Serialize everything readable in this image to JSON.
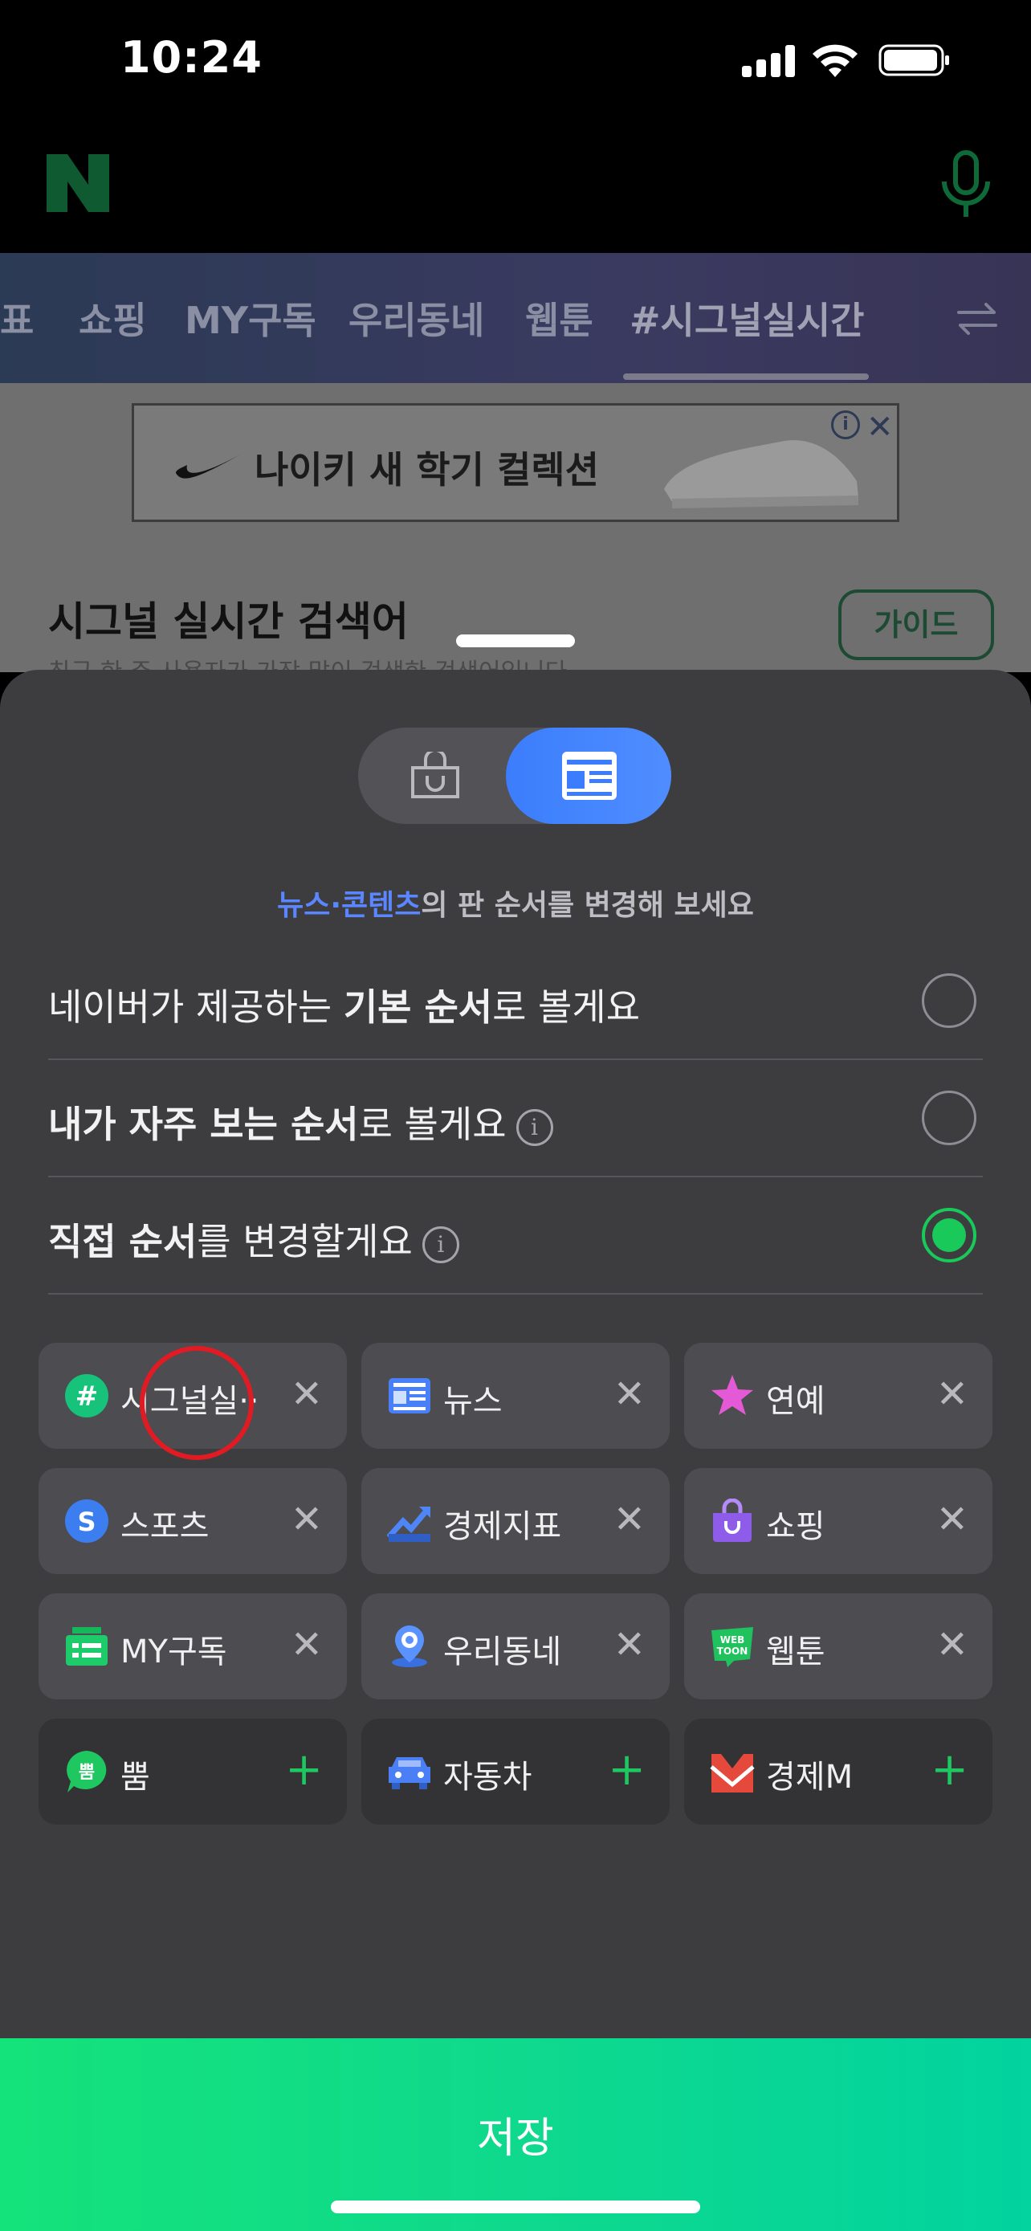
{
  "status_bar": {
    "time": "10:24"
  },
  "tabs": [
    {
      "label": "표"
    },
    {
      "label": "쇼핑"
    },
    {
      "label": "MY구독"
    },
    {
      "label": "우리동네"
    },
    {
      "label": "웹툰"
    },
    {
      "label": "#시그널실시간",
      "active": true
    }
  ],
  "ad": {
    "text": "나이키 새 학기 컬렉션",
    "info": "i",
    "close": "✕"
  },
  "section": {
    "title": "시그널 실시간 검색어",
    "subtitle": "최근 한 주 사용자가 가장 많이 검색한 검색어입니다",
    "guide_button": "가이드"
  },
  "sheet": {
    "hint_accent": "뉴스·콘텐츠",
    "hint_rest": "의 판 순서를 변경해 보세요",
    "options": [
      {
        "pre": "네이버가 제공하는 ",
        "bold": "기본 순서",
        "post": "로 볼게요",
        "info": false,
        "selected": false
      },
      {
        "pre": "",
        "bold": "내가 자주 보는 순서",
        "post": "로 볼게요",
        "info": true,
        "selected": false
      },
      {
        "pre": "",
        "bold": "직접 순서",
        "post": "를 변경할게요",
        "info": true,
        "selected": true
      }
    ],
    "chips": [
      {
        "label": "시그널실··",
        "icon": "hashtag-icon",
        "action": "✕",
        "added": true
      },
      {
        "label": "뉴스",
        "icon": "news-icon",
        "action": "✕",
        "added": true
      },
      {
        "label": "연예",
        "icon": "star-icon",
        "action": "✕",
        "added": true
      },
      {
        "label": "스포츠",
        "icon": "sports-icon",
        "action": "✕",
        "added": true
      },
      {
        "label": "경제지표",
        "icon": "chart-icon",
        "action": "✕",
        "added": true
      },
      {
        "label": "쇼핑",
        "icon": "shopping-bag-icon",
        "action": "✕",
        "added": true
      },
      {
        "label": "MY구독",
        "icon": "subscription-icon",
        "action": "✕",
        "added": true
      },
      {
        "label": "우리동네",
        "icon": "location-icon",
        "action": "✕",
        "added": true
      },
      {
        "label": "웹툰",
        "icon": "webtoon-icon",
        "action": "✕",
        "added": true
      },
      {
        "label": "뿜",
        "icon": "ppum-icon",
        "action": "+",
        "added": false
      },
      {
        "label": "자동차",
        "icon": "car-icon",
        "action": "+",
        "added": false
      },
      {
        "label": "경제M",
        "icon": "economy-m-icon",
        "action": "+",
        "added": false
      }
    ],
    "save": "저장"
  },
  "colors": {
    "accent_green": "#19c95a",
    "accent_blue": "#3b7dfc",
    "sheet_bg": "#3d3d40"
  }
}
